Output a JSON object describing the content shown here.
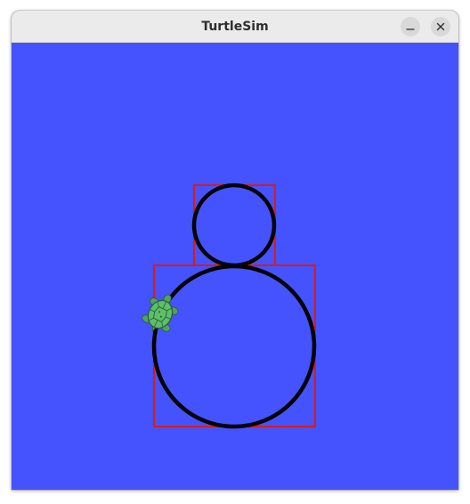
{
  "window": {
    "title": "TurtleSim",
    "controls": {
      "minimize_icon": "minimize-icon",
      "close_icon": "close-icon"
    }
  },
  "canvas": {
    "background_color": "#4553ff",
    "pen_color": "#000000",
    "box_color": "#d81b1b"
  },
  "turtle": {
    "icon": "turtle-icon",
    "shell_color": "#5cbf6a"
  }
}
